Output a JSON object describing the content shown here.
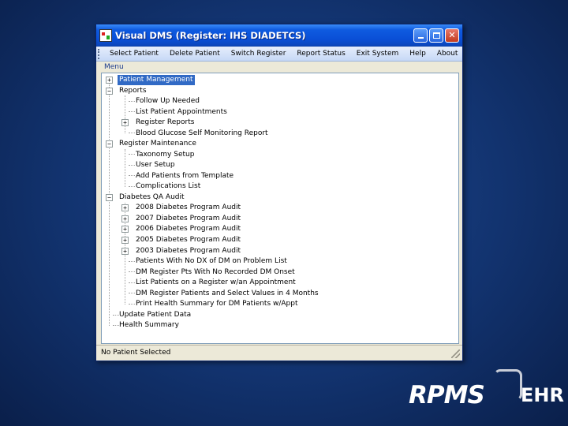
{
  "window": {
    "title": "Visual DMS (Register: IHS DIADETCS)"
  },
  "menubar": {
    "items": [
      "Select Patient",
      "Delete Patient",
      "Switch Register",
      "Report Status",
      "Exit System",
      "Help",
      "About"
    ]
  },
  "group_label": "Menu",
  "tree": {
    "nodes": [
      "Patient Management",
      "Reports",
      "Follow Up Needed",
      "List Patient Appointments",
      "Register Reports",
      "Blood Glucose Self Monitoring Report",
      "Register Maintenance",
      "Taxonomy Setup",
      "User Setup",
      "Add Patients from Template",
      "Complications List",
      "Diabetes QA Audit",
      "2008 Diabetes Program Audit",
      "2007 Diabetes Program Audit",
      "2006 Diabetes Program Audit",
      "2005 Diabetes Program Audit",
      "2003 Diabetes Program Audit",
      "Patients With No DX of DM on Problem List",
      "DM Register Pts With No Recorded DM Onset",
      "List Patients on a Register w/an Appointment",
      "DM Register Patients and Select Values in 4 Months",
      "Print Health Summary for DM Patients w/Appt",
      "Update Patient Data",
      "Health Summary"
    ]
  },
  "status": "No Patient Selected",
  "logo": {
    "main": "RPMS",
    "suffix": "EHR"
  }
}
